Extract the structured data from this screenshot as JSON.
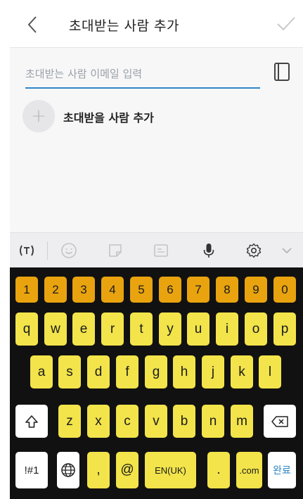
{
  "header": {
    "title": "초대받는 사람 추가"
  },
  "email_input": {
    "placeholder": "초대받는 사람 이메일 입력",
    "value": ""
  },
  "add_person": {
    "plus": "+",
    "label": "초대받을 사람 추가"
  },
  "keyboard": {
    "number_row": [
      "1",
      "2",
      "3",
      "4",
      "5",
      "6",
      "7",
      "8",
      "9",
      "0"
    ],
    "row1": [
      "q",
      "w",
      "e",
      "r",
      "t",
      "y",
      "u",
      "i",
      "o",
      "p"
    ],
    "row2": [
      "a",
      "s",
      "d",
      "f",
      "g",
      "h",
      "j",
      "k",
      "l"
    ],
    "row3": [
      "z",
      "x",
      "c",
      "v",
      "b",
      "n",
      "m"
    ],
    "symbols_label": "!#1",
    "comma": ",",
    "at": "@",
    "space_label": "EN(UK)",
    "period": ".",
    "dotcom": ".com",
    "done_label": "완료"
  },
  "colors": {
    "accent_blue": "#2f86c7",
    "number_key": "#e8a30f",
    "letter_key": "#f2e44a",
    "keyboard_bg": "#111111"
  }
}
